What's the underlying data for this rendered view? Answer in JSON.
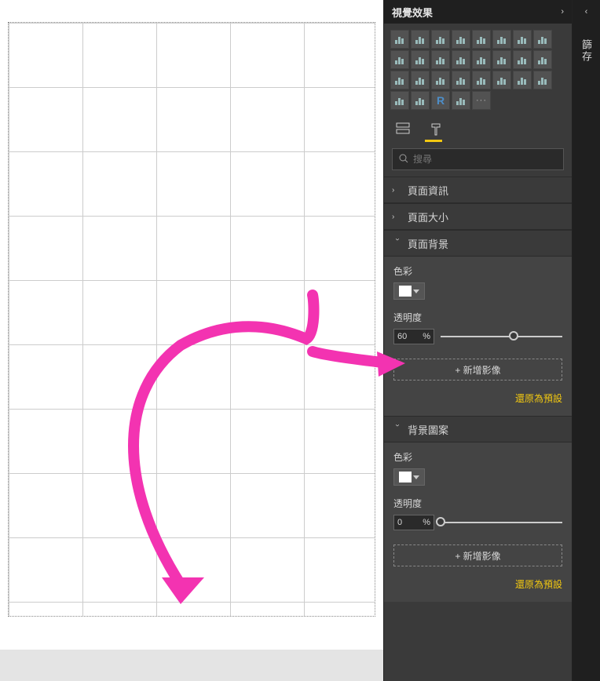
{
  "sidebar": {
    "title": "視覺效果",
    "search_placeholder": "搜尋",
    "sections": {
      "page_info": {
        "label": "頁面資訊"
      },
      "page_size": {
        "label": "頁面大小"
      },
      "page_background": {
        "label": "頁面背景",
        "color_label": "色彩",
        "opacity_label": "透明度",
        "opacity_value": "60",
        "opacity_unit": "%",
        "opacity_thumb_percent": 60,
        "add_image_label": "+ 新增影像",
        "reset_label": "還原為預設"
      },
      "background_pattern": {
        "label": "背景圖案",
        "color_label": "色彩",
        "opacity_label": "透明度",
        "opacity_value": "0",
        "opacity_unit": "%",
        "opacity_thumb_percent": 0,
        "add_image_label": "+ 新增影像",
        "reset_label": "還原為預設"
      }
    }
  },
  "edge": {
    "label": "篩存"
  },
  "viz_icons": [
    "stacked-bar",
    "clustered-bar",
    "stacked-column",
    "clustered-column",
    "100-bar",
    "100-column",
    "line",
    "area",
    "stacked-area",
    "line-column",
    "ribbon",
    "waterfall",
    "scatter",
    "pie",
    "donut",
    "treemap",
    "map",
    "filled-map",
    "funnel",
    "gauge",
    "card",
    "multi-card",
    "kpi",
    "slicer",
    "table",
    "matrix",
    "r",
    "python-globe",
    "more"
  ]
}
